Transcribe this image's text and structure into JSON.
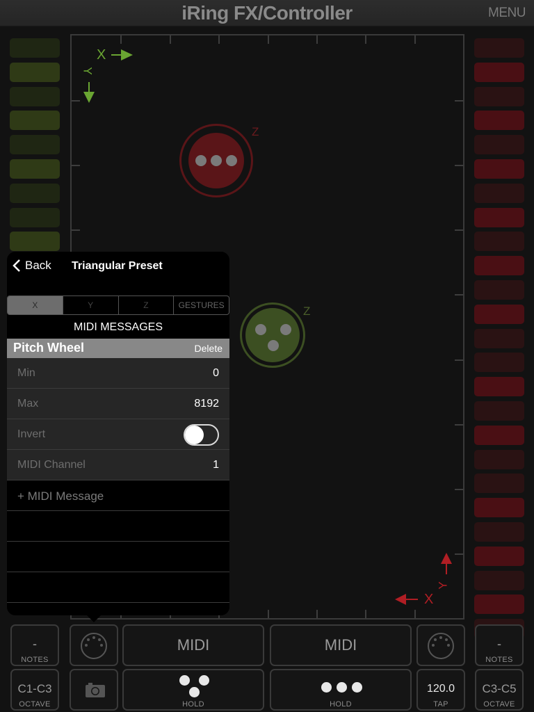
{
  "header": {
    "title": "iRing FX/Controller",
    "menu_label": "MENU"
  },
  "colors": {
    "green_accent": "#6aa532",
    "red_accent": "#b01e24",
    "green_ring": "#3c4f22",
    "red_ring": "#5a1518"
  },
  "left_meter": {
    "levels": [
      "dim",
      "lit",
      "dim",
      "lit",
      "dim",
      "lit",
      "dim",
      "dim",
      "lit"
    ]
  },
  "right_meter": {
    "levels": [
      "dim",
      "lit",
      "dim",
      "lit",
      "dim",
      "lit",
      "dim",
      "lit",
      "dim",
      "lit",
      "dim",
      "lit",
      "dim",
      "dim",
      "lit",
      "dim",
      "lit",
      "dim",
      "dim",
      "lit",
      "dim",
      "lit",
      "dim",
      "lit",
      "dim"
    ]
  },
  "pad": {
    "green_axes": {
      "x": "X",
      "y": "Y"
    },
    "red_axes": {
      "x": "X",
      "y": "Y"
    },
    "red_ring_label": "Z",
    "green_ring_label": "Z"
  },
  "popup": {
    "back_label": "Back",
    "title": "Triangular Preset",
    "tabs": [
      {
        "label": "X",
        "active": true
      },
      {
        "label": "Y",
        "active": false
      },
      {
        "label": "Z",
        "active": false
      },
      {
        "label": "GESTURES",
        "active": false
      }
    ],
    "section_title": "MIDI MESSAGES",
    "message": {
      "name": "Pitch Wheel",
      "delete_label": "Delete",
      "min_label": "Min",
      "min_value": "0",
      "max_label": "Max",
      "max_value": "8192",
      "invert_label": "Invert",
      "invert_on": false,
      "channel_label": "MIDI Channel",
      "channel_value": "1"
    },
    "add_label": "+ MIDI Message"
  },
  "controls": {
    "left_notes_value": "-",
    "left_notes_label": "NOTES",
    "left_octave_value": "C1-C3",
    "left_octave_label": "OCTAVE",
    "left_midi_label": "MIDI",
    "left_hold_label": "HOLD",
    "right_midi_label": "MIDI",
    "right_hold_label": "HOLD",
    "tap_value": "120.0",
    "tap_label": "TAP",
    "right_notes_value": "-",
    "right_notes_label": "NOTES",
    "right_octave_value": "C3-C5",
    "right_octave_label": "OCTAVE"
  }
}
